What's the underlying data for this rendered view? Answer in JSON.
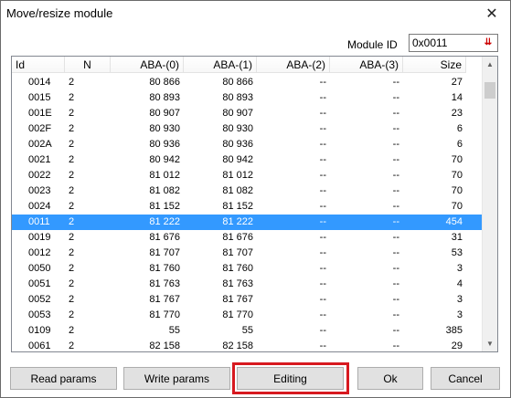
{
  "window": {
    "title": "Move/resize module"
  },
  "module": {
    "label": "Module ID",
    "value": "0x0011",
    "icon": "sort-down-arrow-icon"
  },
  "table": {
    "columns": [
      "Id",
      "N",
      "ABA-(0)",
      "ABA-(1)",
      "ABA-(2)",
      "ABA-(3)",
      "Size"
    ],
    "rows": [
      {
        "id": "0014",
        "n": "2",
        "a0": "80 866",
        "a1": "80 866",
        "a2": "--",
        "a3": "--",
        "size": "27"
      },
      {
        "id": "0015",
        "n": "2",
        "a0": "80 893",
        "a1": "80 893",
        "a2": "--",
        "a3": "--",
        "size": "14"
      },
      {
        "id": "001E",
        "n": "2",
        "a0": "80 907",
        "a1": "80 907",
        "a2": "--",
        "a3": "--",
        "size": "23"
      },
      {
        "id": "002F",
        "n": "2",
        "a0": "80 930",
        "a1": "80 930",
        "a2": "--",
        "a3": "--",
        "size": "6"
      },
      {
        "id": "002A",
        "n": "2",
        "a0": "80 936",
        "a1": "80 936",
        "a2": "--",
        "a3": "--",
        "size": "6"
      },
      {
        "id": "0021",
        "n": "2",
        "a0": "80 942",
        "a1": "80 942",
        "a2": "--",
        "a3": "--",
        "size": "70"
      },
      {
        "id": "0022",
        "n": "2",
        "a0": "81 012",
        "a1": "81 012",
        "a2": "--",
        "a3": "--",
        "size": "70"
      },
      {
        "id": "0023",
        "n": "2",
        "a0": "81 082",
        "a1": "81 082",
        "a2": "--",
        "a3": "--",
        "size": "70"
      },
      {
        "id": "0024",
        "n": "2",
        "a0": "81 152",
        "a1": "81 152",
        "a2": "--",
        "a3": "--",
        "size": "70"
      },
      {
        "id": "0011",
        "n": "2",
        "a0": "81 222",
        "a1": "81 222",
        "a2": "--",
        "a3": "--",
        "size": "454",
        "selected": true
      },
      {
        "id": "0019",
        "n": "2",
        "a0": "81 676",
        "a1": "81 676",
        "a2": "--",
        "a3": "--",
        "size": "31"
      },
      {
        "id": "0012",
        "n": "2",
        "a0": "81 707",
        "a1": "81 707",
        "a2": "--",
        "a3": "--",
        "size": "53"
      },
      {
        "id": "0050",
        "n": "2",
        "a0": "81 760",
        "a1": "81 760",
        "a2": "--",
        "a3": "--",
        "size": "3"
      },
      {
        "id": "0051",
        "n": "2",
        "a0": "81 763",
        "a1": "81 763",
        "a2": "--",
        "a3": "--",
        "size": "4"
      },
      {
        "id": "0052",
        "n": "2",
        "a0": "81 767",
        "a1": "81 767",
        "a2": "--",
        "a3": "--",
        "size": "3"
      },
      {
        "id": "0053",
        "n": "2",
        "a0": "81 770",
        "a1": "81 770",
        "a2": "--",
        "a3": "--",
        "size": "3"
      },
      {
        "id": "0109",
        "n": "2",
        "a0": "55",
        "a1": "55",
        "a2": "--",
        "a3": "--",
        "size": "385"
      },
      {
        "id": "0061",
        "n": "2",
        "a0": "82 158",
        "a1": "82 158",
        "a2": "--",
        "a3": "--",
        "size": "29"
      }
    ]
  },
  "buttons": {
    "read": "Read params",
    "write": "Write params",
    "edit": "Editing",
    "ok": "Ok",
    "cancel": "Cancel"
  },
  "colors": {
    "selection": "#3399ff",
    "highlight": "#d7191f"
  }
}
